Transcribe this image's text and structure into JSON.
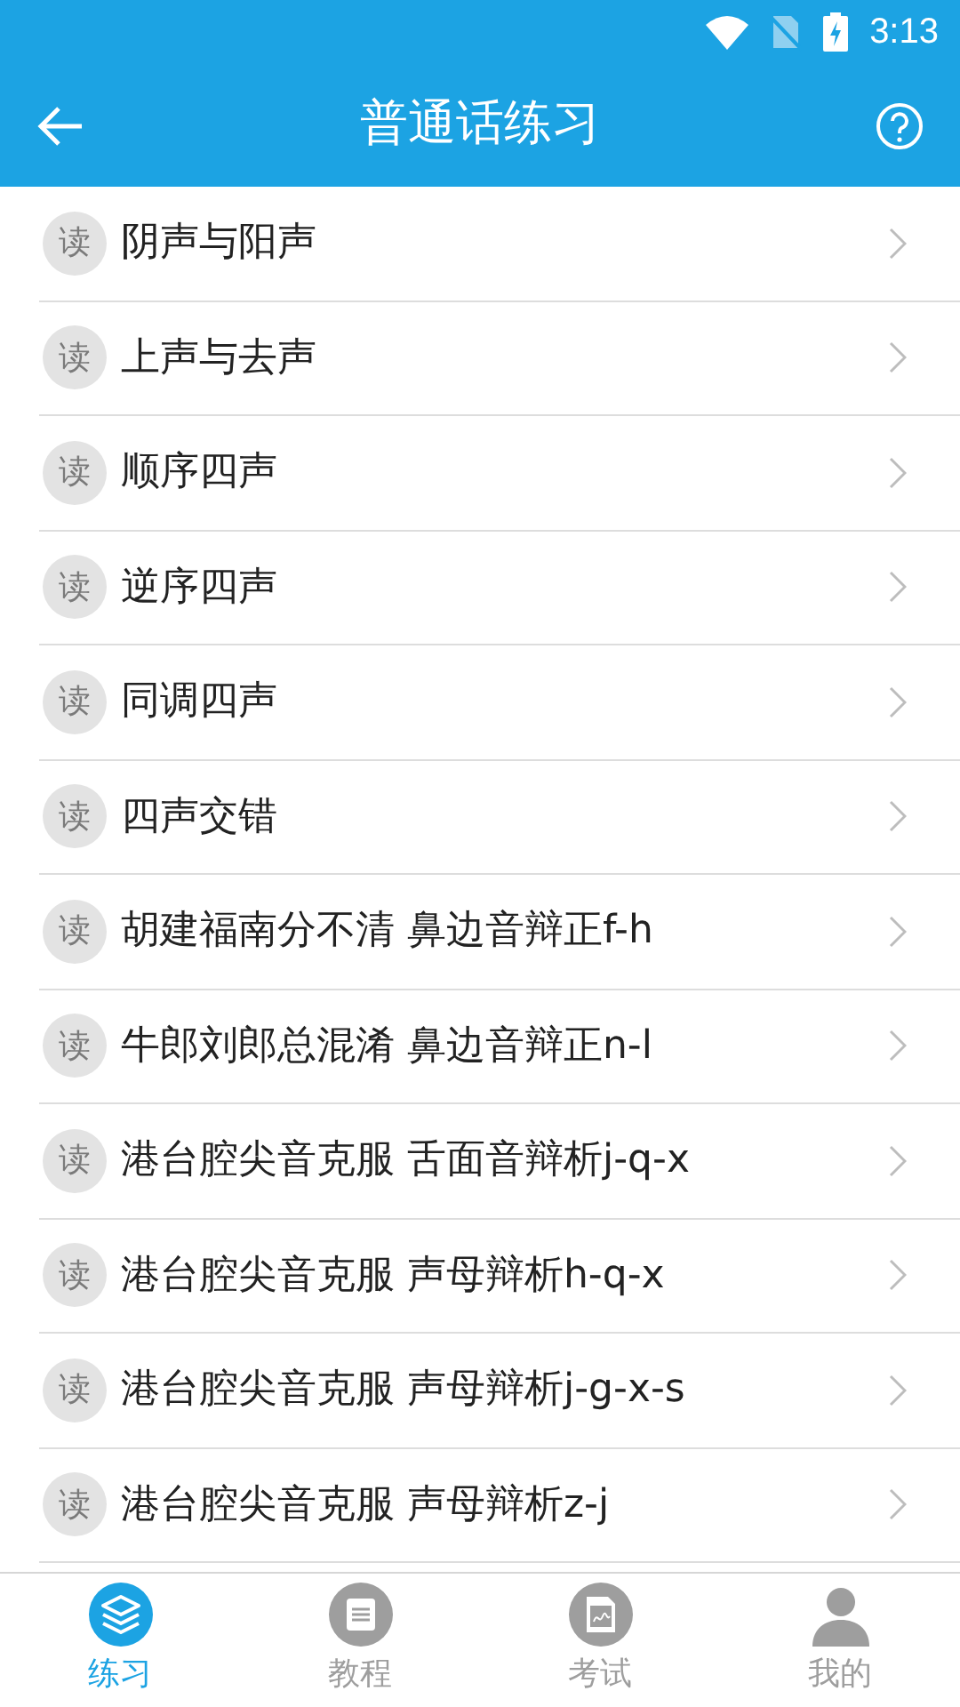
{
  "status_bar": {
    "time": "3:13"
  },
  "header": {
    "title": "普通话练习"
  },
  "items": [
    {
      "badge": "读",
      "label": "阴声与阳声"
    },
    {
      "badge": "读",
      "label": "上声与去声"
    },
    {
      "badge": "读",
      "label": "顺序四声"
    },
    {
      "badge": "读",
      "label": "逆序四声"
    },
    {
      "badge": "读",
      "label": "同调四声"
    },
    {
      "badge": "读",
      "label": "四声交错"
    },
    {
      "badge": "读",
      "label": "胡建福南分不清 鼻边音辩正f-h"
    },
    {
      "badge": "读",
      "label": "牛郎刘郎总混淆 鼻边音辩正n-l"
    },
    {
      "badge": "读",
      "label": "港台腔尖音克服 舌面音辩析j-q-x"
    },
    {
      "badge": "读",
      "label": "港台腔尖音克服 声母辩析h-q-x"
    },
    {
      "badge": "读",
      "label": "港台腔尖音克服 声母辩析j-g-x-s"
    },
    {
      "badge": "读",
      "label": "港台腔尖音克服 声母辩析z-j"
    }
  ],
  "tabs": [
    {
      "kind": "practice",
      "label": "练习",
      "selected": true
    },
    {
      "kind": "tutorial",
      "label": "教程",
      "selected": false
    },
    {
      "kind": "exam",
      "label": "考试",
      "selected": false
    },
    {
      "kind": "profile",
      "label": "我的",
      "selected": false
    }
  ]
}
